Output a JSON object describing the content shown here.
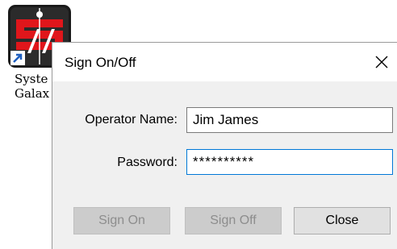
{
  "desktop": {
    "shortcut": {
      "icon": "system-galaxy-app-icon",
      "label_line1": "Syste",
      "label_line2": "Galax"
    }
  },
  "dialog": {
    "title": "Sign On/Off",
    "close_glyph": "✕",
    "operator_name_label": "Operator Name:",
    "operator_name_value": "Jim James",
    "password_label": "Password:",
    "password_value": "**********",
    "buttons": {
      "sign_on": "Sign On",
      "sign_off": "Sign Off",
      "close": "Close"
    }
  },
  "colors": {
    "focus_border": "#0078d7",
    "icon_red": "#e0161b",
    "icon_dark": "#1a1a1a"
  }
}
